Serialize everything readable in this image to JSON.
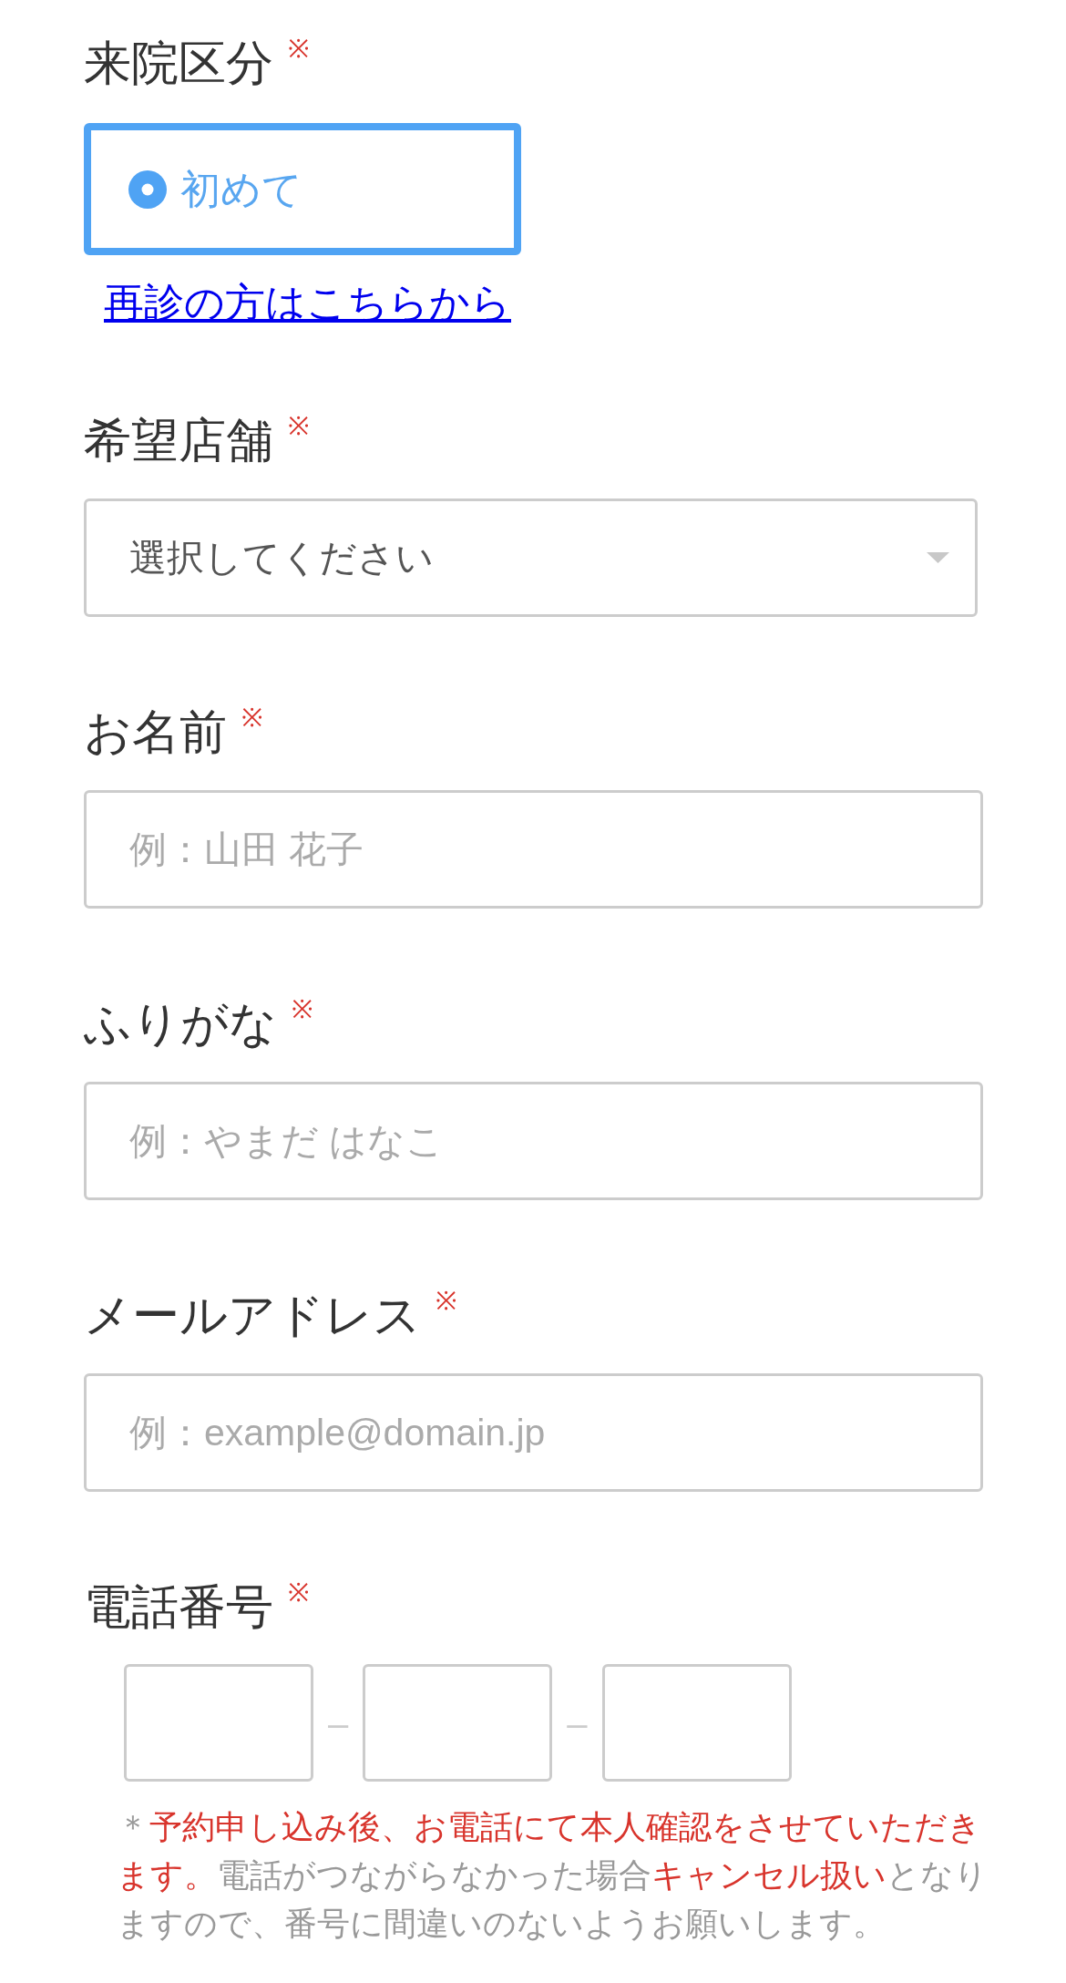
{
  "fields": [
    {
      "kind": "radio",
      "label": "来院区分",
      "required_mark": "※",
      "options": [
        {
          "label": "初めて",
          "selected": true
        }
      ],
      "link": "再診の方はこちらから"
    },
    {
      "kind": "select",
      "label": "希望店舗",
      "required_mark": "※",
      "value": "選択してください"
    },
    {
      "kind": "text",
      "label": "お名前",
      "required_mark": "※",
      "placeholder": "例：山田 花子"
    },
    {
      "kind": "text",
      "label": "ふりがな",
      "required_mark": "※",
      "placeholder": "例：やまだ はなこ"
    },
    {
      "kind": "text",
      "label": "メールアドレス",
      "required_mark": "※",
      "placeholder": "例：example@domain.jp"
    },
    {
      "kind": "phone",
      "label": "電話番号",
      "required_mark": "※",
      "parts": [
        {
          "kind": "input"
        },
        {
          "kind": "separator",
          "text": "–"
        },
        {
          "kind": "input"
        },
        {
          "kind": "separator",
          "text": "–"
        },
        {
          "kind": "input"
        }
      ],
      "note": [
        {
          "text": "＊",
          "emphasis": false
        },
        {
          "text": "予約申し込み後、お電話にて本人確認をさせていただきます。",
          "emphasis": true
        },
        {
          "text": "電話がつながらなかった場合",
          "emphasis": false
        },
        {
          "text": "キャンセル扱い",
          "emphasis": true
        },
        {
          "text": "となりますので、番号に間違いのないようお願いします。",
          "emphasis": false
        }
      ]
    }
  ]
}
